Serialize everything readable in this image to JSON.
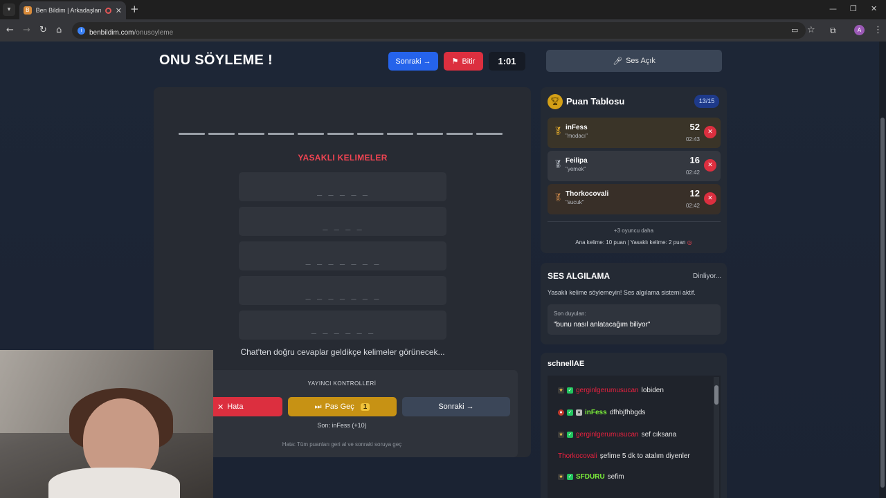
{
  "browser": {
    "tab_title": "Ben Bildim | Arkadaşlarınla",
    "url_host": "benbildim.com",
    "url_path": "/onusoyleme",
    "profile_initial": "A"
  },
  "game": {
    "title": "ONU SÖYLEME !",
    "next_label": "Sonraki →",
    "finish_label": "Bitir",
    "timer": "1:01",
    "forbidden_title": "YASAKLI KELIMELER",
    "forbidden_masks": [
      "_ _ _ _ _",
      "_ _ _ _",
      "_ _ _ _ _ _ _",
      "_ _ _ _ _ _ _",
      "_ _ _ _ _ _"
    ],
    "chat_hint": "Chat'ten doğru cevaplar geldikçe kelimeler görünecek...",
    "host": {
      "title": "YAYINCI KONTROLLERİ",
      "error_label": "Hata",
      "pass_label": "Pas Geç",
      "pass_count": "1",
      "next_label": "Sonraki →",
      "last_info": "Son: inFess (+10)",
      "error_info": "Hata: Tüm puanları geri al ve sonraki soruya geç"
    }
  },
  "voice_button": "Ses Açık",
  "scoreboard": {
    "title": "Puan Tablosu",
    "count": "13/15",
    "players": [
      {
        "name": "inFess",
        "word": "\"modacı\"",
        "score": "52",
        "time": "02:43"
      },
      {
        "name": "Feilipa",
        "word": "\"yemek\"",
        "score": "16",
        "time": "02:42"
      },
      {
        "name": "Thorkocovali",
        "word": "\"sucuk\"",
        "score": "12",
        "time": "02:42"
      }
    ],
    "more_players": "+3 oyuncu daha",
    "rules": "Ana kelime: 10 puan | Yasaklı kelime: 2 puan"
  },
  "voice_detection": {
    "title": "SES ALGILAMA",
    "status": "Dinliyor...",
    "warning": "Yasaklı kelime söylemeyin! Ses algılama sistemi aktif.",
    "heard_label": "Son duyulan:",
    "heard_text": "\"bunu nasıl anlatacağım biliyor\""
  },
  "chat": {
    "channel": "schnellAE",
    "messages": [
      {
        "user": "gerginlgerumusucan",
        "text": "lobiden"
      },
      {
        "user": "inFess",
        "text": "dfhbjfhbgds"
      },
      {
        "user": "gerginlgerumusucan",
        "text": "sef cıksana"
      },
      {
        "user": "Thorkocovali",
        "text": "şefime 5 dk to atalım diyenler"
      },
      {
        "user": "SFDURU",
        "text": "sefim"
      }
    ]
  },
  "colors": {
    "accent_blue": "#2563eb",
    "danger_red": "#dc2f3f",
    "warning_gold": "#c79214",
    "forbidden_title": "#ef4452"
  }
}
